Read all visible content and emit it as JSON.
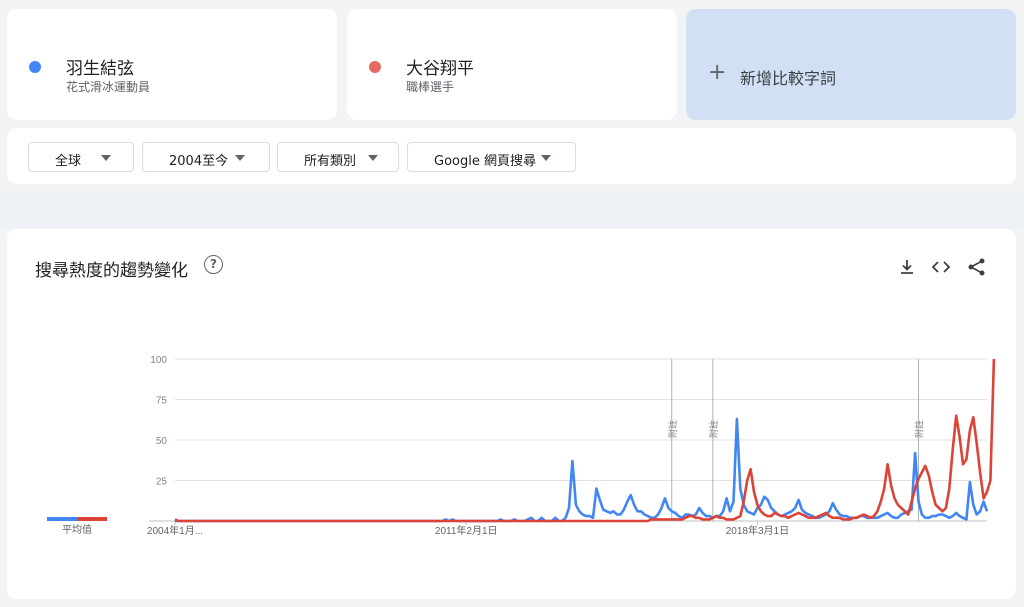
{
  "terms": [
    {
      "name": "羽生結弦",
      "category": "花式滑冰運動員",
      "color": "#4285f4"
    },
    {
      "name": "大谷翔平",
      "category": "職棒選手",
      "color": "#db4437"
    }
  ],
  "add_term": {
    "plus": "+",
    "label": "新增比較字詞"
  },
  "filters": {
    "region": "全球",
    "time": "2004至今",
    "category": "所有類別",
    "property": "Google 網頁搜尋"
  },
  "chart_header": {
    "title": "搜尋熱度的趨勢變化",
    "help": "?"
  },
  "chart_data": {
    "type": "line",
    "ylim": [
      0,
      100
    ],
    "yticks": [
      "100",
      "75",
      "50",
      "25"
    ],
    "ytick_values": [
      100,
      75,
      50,
      25
    ],
    "xtick_labels": [
      "2004年1月...",
      "2011年2月1日",
      "2018年3月1日"
    ],
    "xtick_index": [
      0,
      85,
      170
    ],
    "annotation_label": "附註",
    "annotation_index": [
      145,
      157,
      217
    ],
    "average_label": "平均值",
    "averages": [
      2,
      2
    ],
    "partial_data_from_index": 241,
    "grid": true,
    "series": [
      {
        "name": "羽生結弦",
        "color": "#4285f4",
        "values": [
          0,
          0,
          0,
          0,
          0,
          0,
          0,
          0,
          0,
          0,
          0,
          0,
          0,
          0,
          0,
          0,
          0,
          0,
          0,
          0,
          0,
          0,
          0,
          0,
          0,
          0,
          0,
          0,
          0,
          0,
          0,
          0,
          0,
          0,
          0,
          0,
          0,
          0,
          0,
          0,
          0,
          0,
          0,
          0,
          0,
          0,
          0,
          0,
          0,
          0,
          0,
          0,
          0,
          0,
          0,
          0,
          0,
          0,
          0,
          0,
          0,
          0,
          0,
          0,
          0,
          0,
          0,
          0,
          0,
          0,
          0,
          0,
          0,
          0,
          0,
          0,
          0,
          0,
          0,
          1,
          0,
          1,
          0,
          0,
          0,
          0,
          0,
          0,
          0,
          0,
          0,
          0,
          0,
          0,
          0,
          1,
          0,
          0,
          0,
          1,
          0,
          0,
          0,
          1,
          2,
          0,
          0,
          2,
          0,
          0,
          0,
          2,
          0,
          0,
          2,
          8,
          37,
          10,
          6,
          4,
          3,
          3,
          2,
          20,
          13,
          7,
          6,
          5,
          6,
          4,
          4,
          7,
          12,
          16,
          10,
          6,
          6,
          4,
          3,
          2,
          2,
          4,
          8,
          14,
          8,
          6,
          5,
          3,
          2,
          4,
          4,
          3,
          4,
          8,
          5,
          3,
          3,
          2,
          3,
          3,
          6,
          14,
          6,
          12,
          63,
          20,
          10,
          6,
          5,
          4,
          8,
          10,
          15,
          13,
          8,
          6,
          4,
          3,
          4,
          5,
          6,
          8,
          13,
          7,
          5,
          4,
          3,
          2,
          2,
          3,
          4,
          6,
          11,
          7,
          4,
          3,
          3,
          2,
          2,
          2,
          3,
          3,
          2,
          2,
          2,
          2,
          3,
          4,
          5,
          3,
          2,
          2,
          4,
          5,
          6,
          7,
          42,
          12,
          4,
          2,
          2,
          3,
          3,
          4,
          4,
          3,
          2,
          3,
          5,
          3,
          2,
          1,
          24,
          10,
          4,
          6,
          12,
          6
        ]
      },
      {
        "name": "大谷翔平",
        "color": "#db4437",
        "values": [
          1,
          0,
          0,
          0,
          0,
          0,
          0,
          0,
          0,
          0,
          0,
          0,
          0,
          0,
          0,
          0,
          0,
          0,
          0,
          0,
          0,
          0,
          0,
          0,
          0,
          0,
          0,
          0,
          0,
          0,
          0,
          0,
          0,
          0,
          0,
          0,
          0,
          0,
          0,
          0,
          0,
          0,
          0,
          0,
          0,
          0,
          0,
          0,
          0,
          0,
          0,
          0,
          0,
          0,
          0,
          0,
          0,
          0,
          0,
          0,
          0,
          0,
          0,
          0,
          0,
          0,
          0,
          0,
          0,
          0,
          0,
          0,
          0,
          0,
          0,
          0,
          0,
          0,
          0,
          0,
          0,
          0,
          0,
          0,
          0,
          0,
          0,
          0,
          0,
          0,
          0,
          0,
          0,
          0,
          0,
          0,
          0,
          0,
          0,
          0,
          0,
          0,
          0,
          0,
          0,
          0,
          0,
          0,
          0,
          0,
          0,
          0,
          0,
          0,
          0,
          0,
          0,
          0,
          0,
          0,
          0,
          0,
          0,
          0,
          0,
          0,
          0,
          0,
          0,
          0,
          0,
          0,
          0,
          0,
          0,
          0,
          0,
          0,
          0,
          1,
          1,
          1,
          1,
          1,
          1,
          1,
          1,
          1,
          1,
          2,
          3,
          3,
          2,
          2,
          1,
          1,
          1,
          2,
          3,
          2,
          2,
          1,
          1,
          1,
          2,
          3,
          12,
          25,
          32,
          18,
          10,
          6,
          4,
          3,
          3,
          5,
          4,
          3,
          3,
          2,
          3,
          4,
          5,
          4,
          3,
          2,
          2,
          2,
          3,
          4,
          5,
          3,
          2,
          2,
          2,
          1,
          1,
          1,
          2,
          2,
          3,
          4,
          3,
          2,
          3,
          6,
          12,
          20,
          35,
          22,
          14,
          10,
          8,
          6,
          4,
          12,
          20,
          26,
          30,
          34,
          28,
          18,
          10,
          8,
          6,
          8,
          20,
          44,
          65,
          52,
          35,
          38,
          56,
          64,
          48,
          30,
          14,
          18,
          25,
          100
        ]
      }
    ]
  }
}
